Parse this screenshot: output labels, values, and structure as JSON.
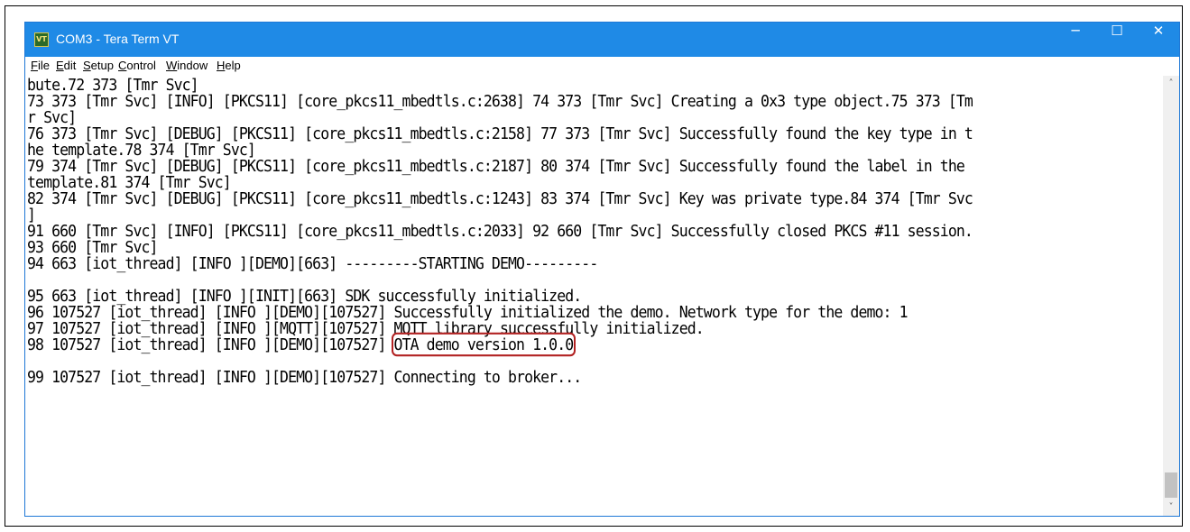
{
  "window": {
    "title": "COM3 - Tera Term VT",
    "icon_label": "VT",
    "controls": {
      "minimize": "─",
      "maximize": "☐",
      "close": "✕"
    }
  },
  "menu": [
    {
      "underline": "F",
      "rest": "ile"
    },
    {
      "underline": "E",
      "rest": "dit"
    },
    {
      "underline": "S",
      "rest": "etup"
    },
    {
      "underline": "C",
      "rest": "ontrol"
    },
    {
      "underline": "W",
      "rest": "indow"
    },
    {
      "underline": "H",
      "rest": "elp"
    }
  ],
  "terminal": {
    "lines": [
      "bute.72 373 [Tmr Svc]",
      "73 373 [Tmr Svc] [INFO] [PKCS11] [core_pkcs11_mbedtls.c:2638] 74 373 [Tmr Svc] Creating a 0x3 type object.75 373 [Tm",
      "r Svc]",
      "76 373 [Tmr Svc] [DEBUG] [PKCS11] [core_pkcs11_mbedtls.c:2158] 77 373 [Tmr Svc] Successfully found the key type in t",
      "he template.78 374 [Tmr Svc]",
      "79 374 [Tmr Svc] [DEBUG] [PKCS11] [core_pkcs11_mbedtls.c:2187] 80 374 [Tmr Svc] Successfully found the label in the",
      "template.81 374 [Tmr Svc]",
      "82 374 [Tmr Svc] [DEBUG] [PKCS11] [core_pkcs11_mbedtls.c:1243] 83 374 [Tmr Svc] Key was private type.84 374 [Tmr Svc",
      "]",
      "91 660 [Tmr Svc] [INFO] [PKCS11] [core_pkcs11_mbedtls.c:2033] 92 660 [Tmr Svc] Successfully closed PKCS #11 session.",
      "93 660 [Tmr Svc]",
      "94 663 [iot_thread] [INFO ][DEMO][663] ---------STARTING DEMO---------",
      "",
      "95 663 [iot_thread] [INFO ][INIT][663] SDK successfully initialized.",
      "96 107527 [iot_thread] [INFO ][DEMO][107527] Successfully initialized the demo. Network type for the demo: 1",
      "97 107527 [iot_thread] [INFO ][MQTT][107527] MQTT library successfully initialized.",
      "98 107527 [iot_thread] [INFO ][DEMO][107527] ",
      "",
      "99 107527 [iot_thread] [INFO ][DEMO][107527] Connecting to broker..."
    ],
    "highlighted_text": "OTA demo version 1.0.0"
  },
  "scrollbar": {
    "up": "˄",
    "down": "˅"
  }
}
